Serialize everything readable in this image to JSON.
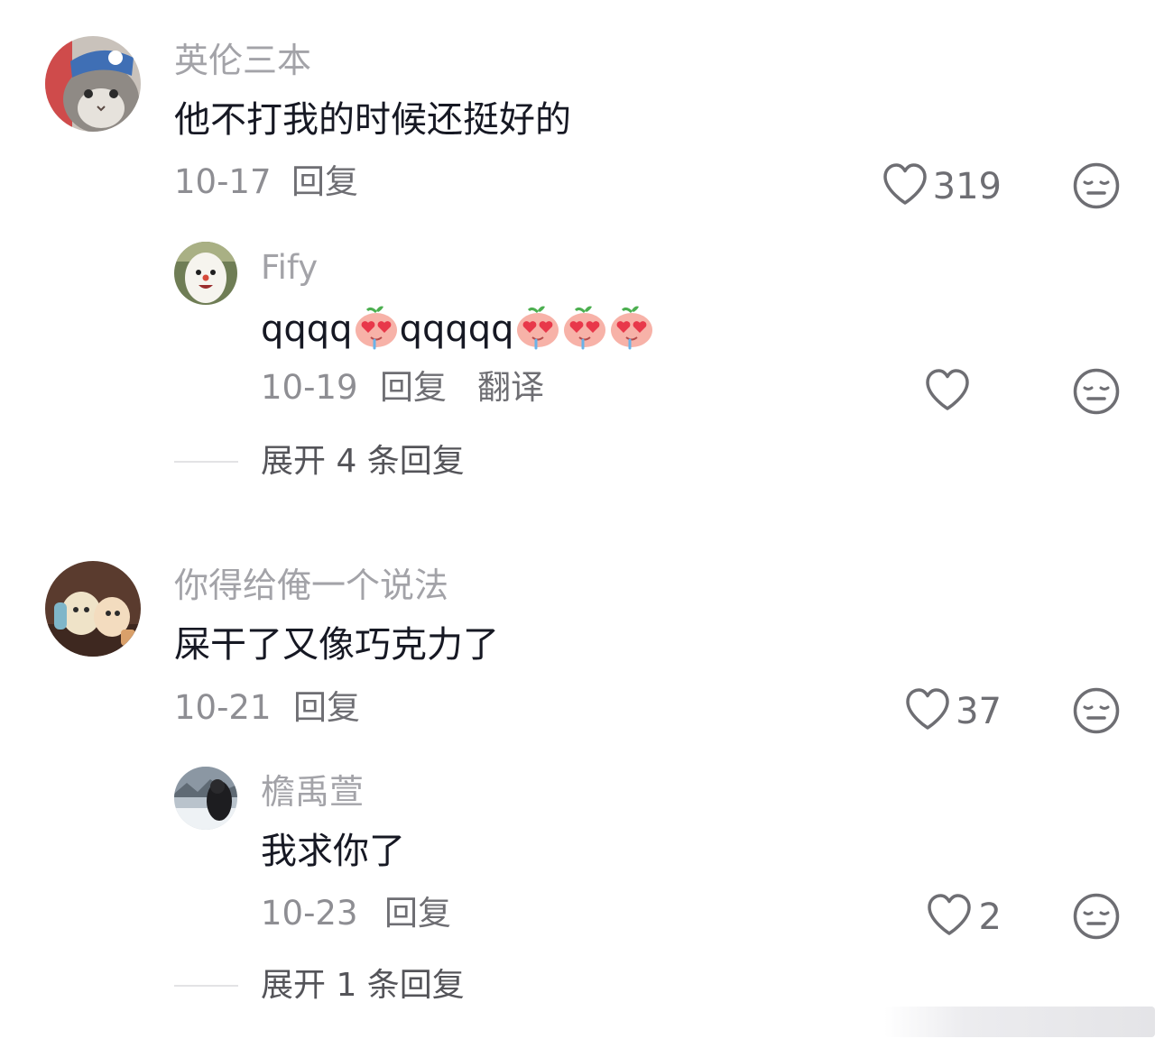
{
  "threads": [
    {
      "user": "英伦三本",
      "text": "他不打我的时候还挺好的",
      "date": "10-17",
      "reply_label": "回复",
      "likes": "319",
      "avatar_icon": "cat-avatar",
      "replies": [
        {
          "user": "Fify",
          "text_parts": [
            "qqqq",
            "qqqqq"
          ],
          "date": "10-19",
          "reply_label": "回复",
          "translate_label": "翻译",
          "likes": "",
          "avatar_icon": "white-creature-avatar"
        }
      ],
      "expand_label": "展开 4 条回复"
    },
    {
      "user": "你得给俺一个说法",
      "text": "屎干了又像巧克力了",
      "date": "10-21",
      "reply_label": "回复",
      "likes": "37",
      "avatar_icon": "plush-toys-avatar",
      "replies": [
        {
          "user": "檐禹萱",
          "text": "我求你了",
          "date": "10-23",
          "reply_label": "回复",
          "likes": "2",
          "avatar_icon": "snow-scene-avatar"
        }
      ],
      "expand_label": "展开 1 条回复"
    }
  ],
  "icons": {
    "like": "heart-outline-icon",
    "dislike": "neutral-face-icon",
    "emoji": "peach-heart-eyes-emoji"
  }
}
